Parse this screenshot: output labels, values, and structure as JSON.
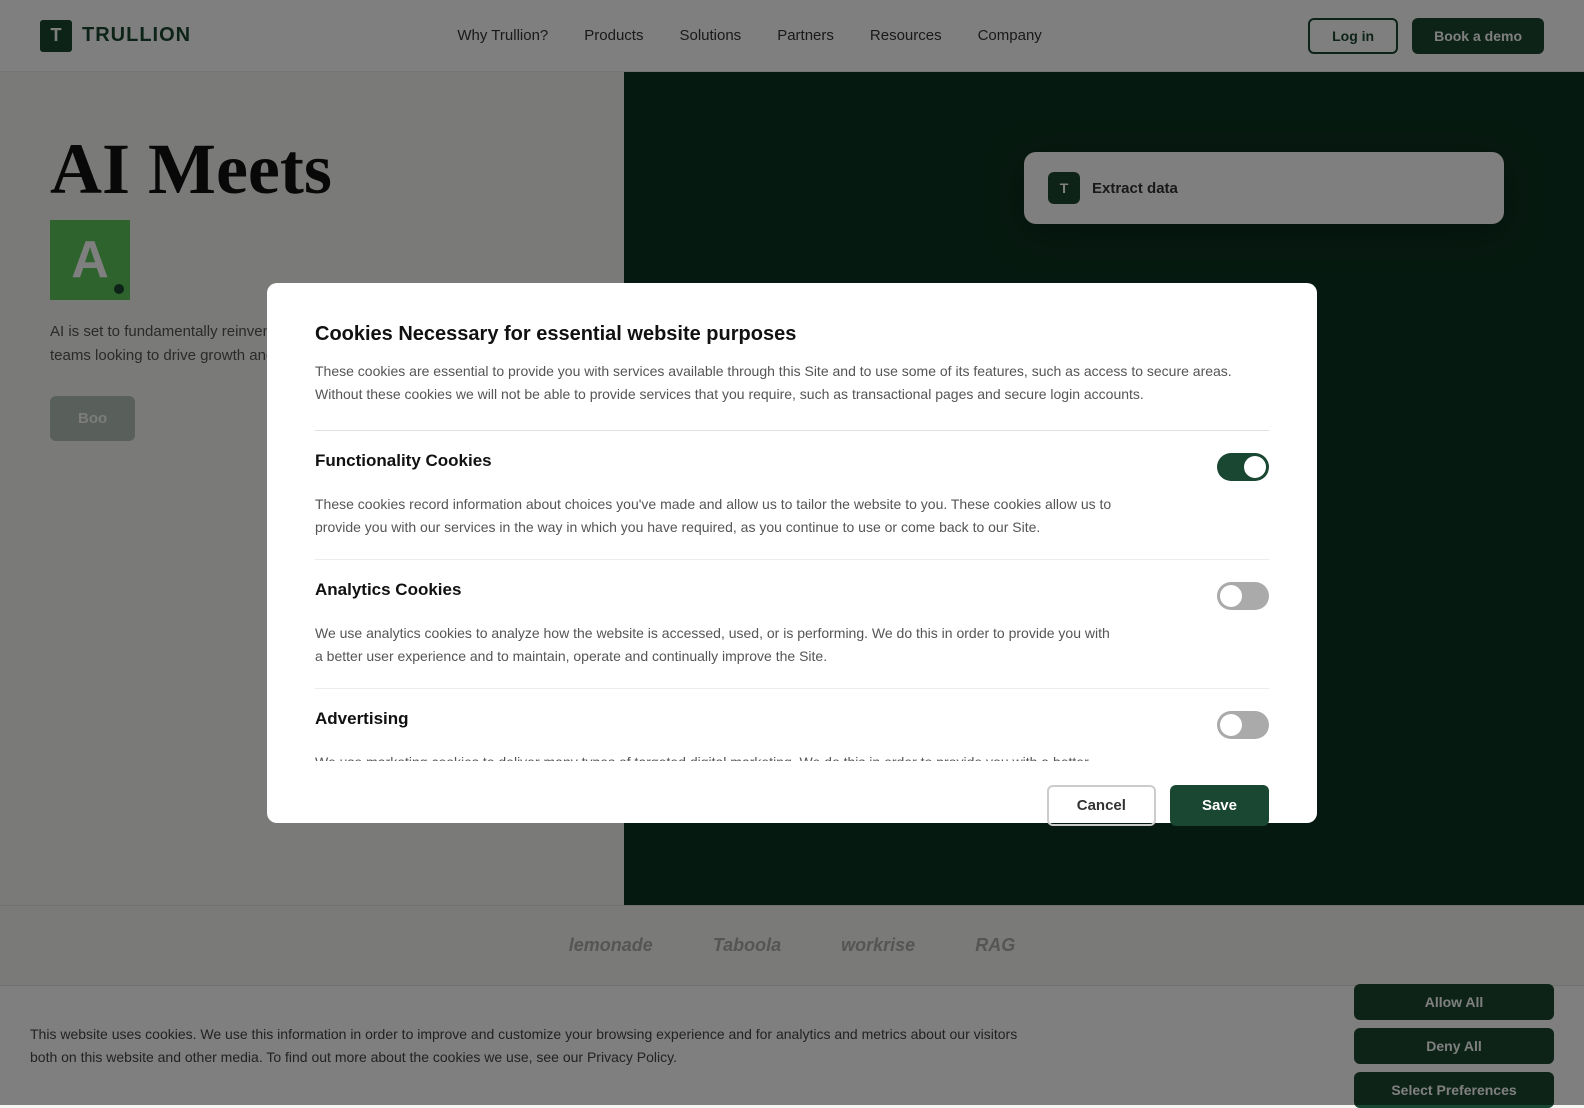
{
  "navbar": {
    "logo_letter": "T",
    "logo_name": "TRULLION",
    "nav_items": [
      "Why Trullion?",
      "Products",
      "Solutions",
      "Partners",
      "Resources",
      "Company"
    ],
    "login_label": "Log in",
    "demo_label": "Book a demo"
  },
  "hero": {
    "heading": "AI Meets",
    "a_letter": "A",
    "body_text": "AI is set to fundamentally reinvent how you work. Trullion is built for finance teams looking to drive growth and reduce risk. Still, t",
    "book_btn": "Boo"
  },
  "extract_card": {
    "icon_letter": "T",
    "title": "Extract data"
  },
  "logo_strip": {
    "logos": [
      "lemonade",
      "Taboola",
      "workrise",
      "RAG"
    ]
  },
  "cookie_banner": {
    "text": "This website uses cookies. We use this information in order to improve and customize your browsing experience and for analytics and metrics about our visitors both on this website and other media. To find out more about the cookies we use, see our Privacy Policy.",
    "privacy_link": "Privacy Policy",
    "allow_all": "Allow All",
    "deny_all": "Deny All",
    "select_prefs": "Select Preferences"
  },
  "modal": {
    "essential_title": "Cookies Necessary for essential website purposes",
    "essential_desc": "These cookies are essential to provide you with services available through this Site and to use some of its features, such as access to secure areas. Without these cookies we will not be able to provide services that you require, such as transactional pages and secure login accounts.",
    "sections": [
      {
        "id": "functionality",
        "title": "Functionality Cookies",
        "desc": "These cookies record information about choices you've made and allow us to tailor the website to you. These cookies allow us to provide you with our services in the way in which you have required, as you continue to use or come back to our Site.",
        "toggle_on": true
      },
      {
        "id": "analytics",
        "title": "Analytics Cookies",
        "desc": "We use analytics cookies to analyze how the website is accessed, used, or is performing. We do this in order to provide you with a better user experience and to maintain, operate and continually improve the Site.",
        "toggle_on": false
      },
      {
        "id": "advertising",
        "title": "Advertising",
        "desc": "We use marketing cookies to deliver many types of targeted digital marketing. We do this in order to provide you with a better user experience and to maintain, operate and continually improve the Site. The cookie store user information and behavior information, which allows advertising services to target audience according to",
        "toggle_on": false
      }
    ],
    "cancel_label": "Cancel",
    "save_label": "Save"
  }
}
